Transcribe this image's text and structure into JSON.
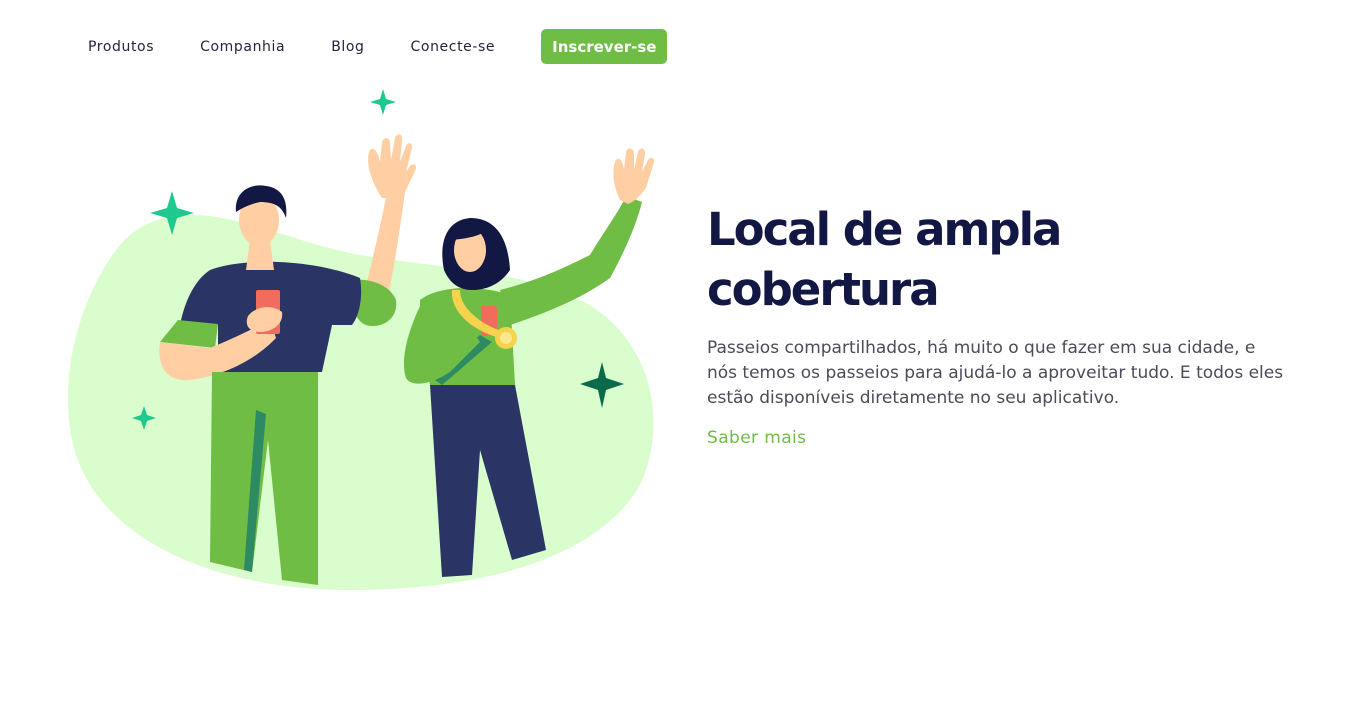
{
  "nav": {
    "items": [
      {
        "label": "Produtos"
      },
      {
        "label": "Companhia"
      },
      {
        "label": "Blog"
      },
      {
        "label": "Conecte-se"
      }
    ],
    "signup_label": "Inscrever-se"
  },
  "hero": {
    "title": "Local de ampla cobertura",
    "description": "Passeios compartilhados, há muito o que fazer em sua cidade, e nós temos os passeios para ajudá-lo a aproveitar tudo. E todos eles estão disponíveis diretamente no seu aplicativo.",
    "link_label": "Saber mais"
  },
  "illustration": {
    "icon": "friends-waving-illustration",
    "colors": {
      "blob": "#d9fdcc",
      "green": "#6fbd44",
      "navy": "#2b3565",
      "skin": "#ffcfa3",
      "sparkle_light": "#1dc98c",
      "sparkle_dark": "#0b6a4a",
      "phone": "#f26c5e",
      "medal": "#f7d24d"
    }
  },
  "theme": {
    "accent": "#6fbd44",
    "heading": "#131743",
    "text": "#4a4b57"
  }
}
